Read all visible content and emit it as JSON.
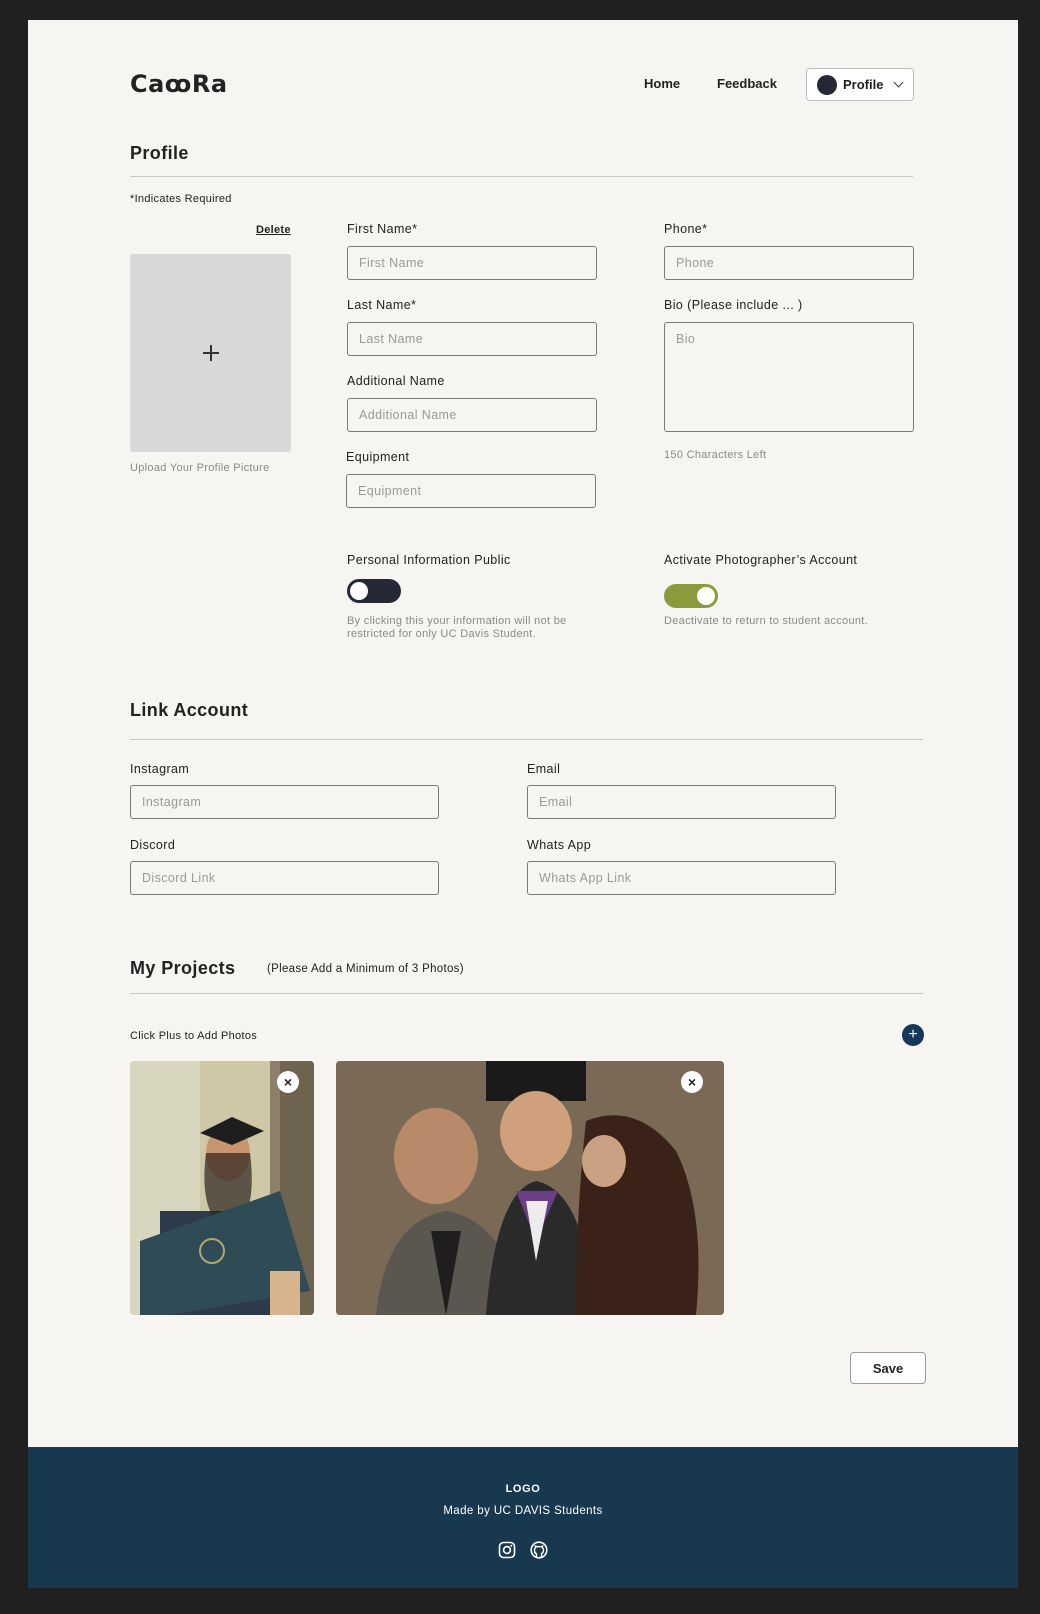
{
  "header": {
    "logo": "CaꝏRa",
    "nav": [
      "Home",
      "Feedback"
    ],
    "profile_label": "Profile"
  },
  "profile": {
    "title": "Profile",
    "required_note": "*Indicates Required",
    "delete_label": "Delete",
    "upload_caption": "Upload Your Profile Picture",
    "fields": {
      "first_name": {
        "label": "First Name*",
        "placeholder": "First Name"
      },
      "last_name": {
        "label": "Last Name*",
        "placeholder": "Last Name"
      },
      "additional_name": {
        "label": "Additional Name",
        "placeholder": "Additional Name"
      },
      "equipment": {
        "label": "Equipment",
        "placeholder": "Equipment"
      },
      "phone": {
        "label": "Phone*",
        "placeholder": "Phone"
      },
      "bio": {
        "label": "Bio (Please include ... )",
        "placeholder": "Bio",
        "counter": "150 Characters Left"
      }
    },
    "toggles": {
      "public_info": {
        "label": "Personal Information Public",
        "hint": "By clicking this your information will not be restricted for only UC Davis Student.",
        "on": false,
        "color": "#262935"
      },
      "photographer": {
        "label": "Activate Photographer’s Account",
        "hint": "Deactivate to return to student account.",
        "on": true,
        "color": "#8a9b3b"
      }
    }
  },
  "link_account": {
    "title": "Link Account",
    "fields": {
      "instagram": {
        "label": "Instagram",
        "placeholder": "Instagram"
      },
      "email": {
        "label": "Email",
        "placeholder": "Email"
      },
      "discord": {
        "label": "Discord",
        "placeholder": "Discord Link"
      },
      "whatsapp": {
        "label": "Whats App",
        "placeholder": "Whats App Link"
      }
    }
  },
  "projects": {
    "title": "My Projects",
    "subtitle": "(Please Add a Minimum of 3 Photos)",
    "instruction": "Click Plus to Add Photos",
    "add_icon": "plus-icon",
    "close_glyph": "×"
  },
  "save_label": "Save",
  "footer": {
    "logo": "LOGO",
    "made_by": "Made by UC DAVIS Students",
    "icons": [
      "instagram-icon",
      "github-icon"
    ],
    "bg_color": "#17384f"
  }
}
